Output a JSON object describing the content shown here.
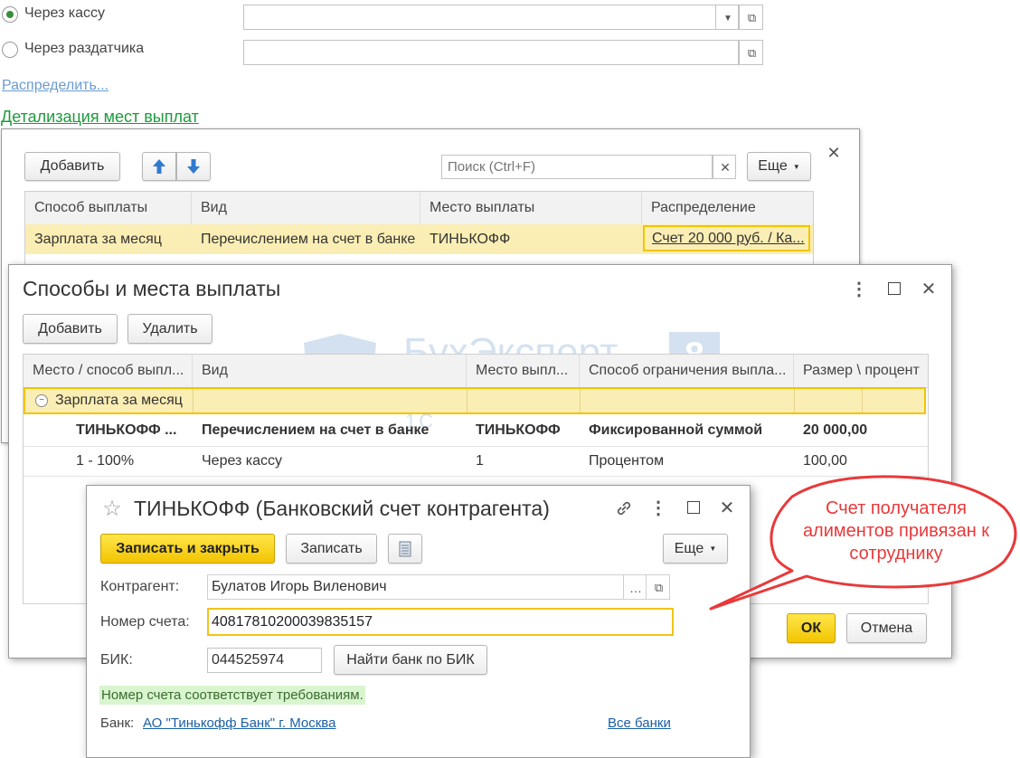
{
  "background": {
    "radio_cashdesk": "Через кассу",
    "radio_distributor": "Через раздатчика",
    "distribute_link": "Распределить...",
    "details_link": "Детализация мест выплат"
  },
  "details_window": {
    "add_button": "Добавить",
    "search_placeholder": "Поиск (Ctrl+F)",
    "more_button": "Еще",
    "columns": [
      "Способ выплаты",
      "Вид",
      "Место выплаты",
      "Распределение"
    ],
    "row": {
      "method": "Зарплата за месяц",
      "kind": "Перечислением на счет в банке",
      "place": "ТИНЬКОФФ",
      "distribution": "Счет 20 000 руб. / Ка..."
    }
  },
  "methods_window": {
    "title": "Способы и места выплаты",
    "add_button": "Добавить",
    "delete_button": "Удалить",
    "columns": [
      "Место / способ выпл...",
      "Вид",
      "Место выпл...",
      "Способ ограничения выпла...",
      "Размер \\ процент"
    ],
    "group_row": "Зарплата за месяц",
    "rows": [
      {
        "place_method": "ТИНЬКОФФ ...",
        "kind": "Перечислением на счет в банке",
        "place": "ТИНЬКОФФ",
        "limit": "Фиксированной суммой",
        "amount": "20 000,00"
      },
      {
        "place_method": "1 - 100%",
        "kind": "Через кассу",
        "place": "1",
        "limit": "Процентом",
        "amount": "100,00"
      }
    ],
    "ok_button": "ОК",
    "cancel_button": "Отмена"
  },
  "account_window": {
    "title": "ТИНЬКОФФ (Банковский счет контрагента)",
    "save_close_button": "Записать и закрыть",
    "save_button": "Записать",
    "more_button": "Еще",
    "counterparty_label": "Контрагент:",
    "counterparty_value": "Булатов Игорь Виленович",
    "account_label": "Номер счета:",
    "account_value": "40817810200039835157",
    "bik_label": "БИК:",
    "bik_value": "044525974",
    "find_bank_button": "Найти банк по БИК",
    "validation_message": "Номер счета соответствует требованиям.",
    "bank_label": "Банк:",
    "bank_value": "АО \"Тинькофф Банк\" г. Москва",
    "all_banks_link": "Все банки"
  },
  "watermark": {
    "brand": "БухЭксперт",
    "digit": "8",
    "tagline": "База ответов по учету в 1С"
  },
  "callout": {
    "text": "Счет получателя алиментов привязан к сотруднику"
  },
  "colors": {
    "link": "#1b5fa8",
    "green_link": "#1e9b3c",
    "selection": "#fbeeb4",
    "accent_yellow": "#f2c400",
    "callout_red": "#e8393a",
    "validation_bg": "#d9f5d0"
  }
}
